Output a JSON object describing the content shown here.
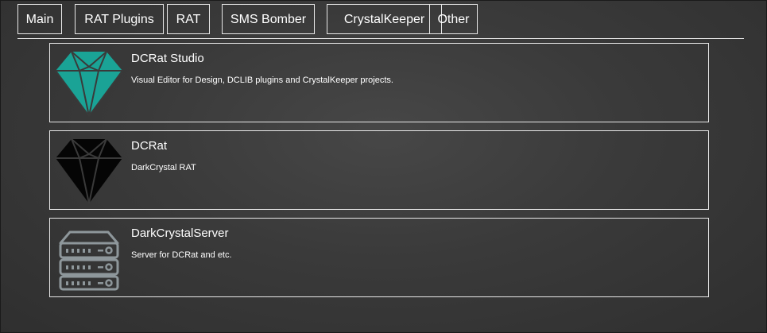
{
  "nav": {
    "tabs": [
      {
        "label": "Main"
      },
      {
        "label": "RAT Plugins"
      },
      {
        "label": "RAT"
      },
      {
        "label": "SMS Bomber"
      },
      {
        "label": "CrystalKeeper"
      },
      {
        "label": "Other"
      }
    ]
  },
  "items": [
    {
      "title": "DCRat Studio",
      "description": "Visual Editor for Design, DCLIB plugins and CrystalKeeper projects.",
      "icon": "diamond-icon",
      "icon_color": "#1aa396"
    },
    {
      "title": "DCRat",
      "description": "DarkCrystal RAT",
      "icon": "diamond-icon",
      "icon_color": "#050505"
    },
    {
      "title": "DarkCrystalServer",
      "description": "Server for DCRat and etc.",
      "icon": "server-icon",
      "icon_color": "#8e979b"
    }
  ],
  "colors": {
    "background": "#383838",
    "border": "#e8e8e8",
    "text": "#ffffff"
  }
}
